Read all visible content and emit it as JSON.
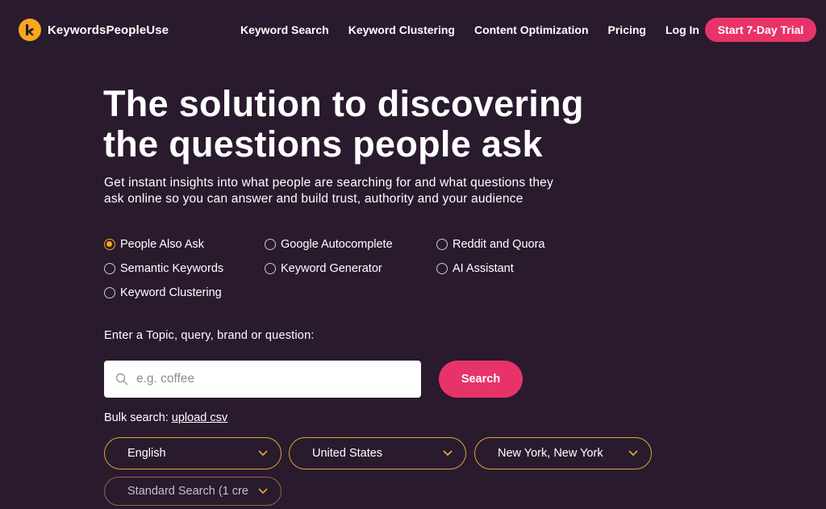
{
  "brand": {
    "name": "KeywordsPeopleUse",
    "accent": "#f7a81b",
    "cta_color": "#e8336a",
    "bg": "#2a1a2e"
  },
  "nav": {
    "links": [
      "Keyword Search",
      "Keyword Clustering",
      "Content Optimization",
      "Pricing",
      "Log In"
    ],
    "trial_label": "Start 7-Day Trial"
  },
  "hero": {
    "title_line1": "The solution to discovering",
    "title_line2": "the questions people ask",
    "subtitle_line1": "Get instant insights into what people are searching for and what questions they",
    "subtitle_line2": "ask online so you can answer and build trust, authority and your audience"
  },
  "modes": [
    {
      "label": "People Also Ask",
      "checked": true
    },
    {
      "label": "Google Autocomplete",
      "checked": false
    },
    {
      "label": "Reddit and Quora",
      "checked": false
    },
    {
      "label": "Semantic Keywords",
      "checked": false
    },
    {
      "label": "Keyword Generator",
      "checked": false
    },
    {
      "label": "AI Assistant",
      "checked": false
    },
    {
      "label": "Keyword Clustering",
      "checked": false
    }
  ],
  "search": {
    "prompt": "Enter a Topic, query, brand or question:",
    "placeholder": "e.g. coffee",
    "value": "",
    "button_label": "Search",
    "icon": "search-icon"
  },
  "bulk": {
    "label": "Bulk search:",
    "link": "upload csv"
  },
  "selects": {
    "language": "English",
    "country": "United States",
    "location": "New York, New York",
    "search_type": "Standard Search (1 cre"
  }
}
